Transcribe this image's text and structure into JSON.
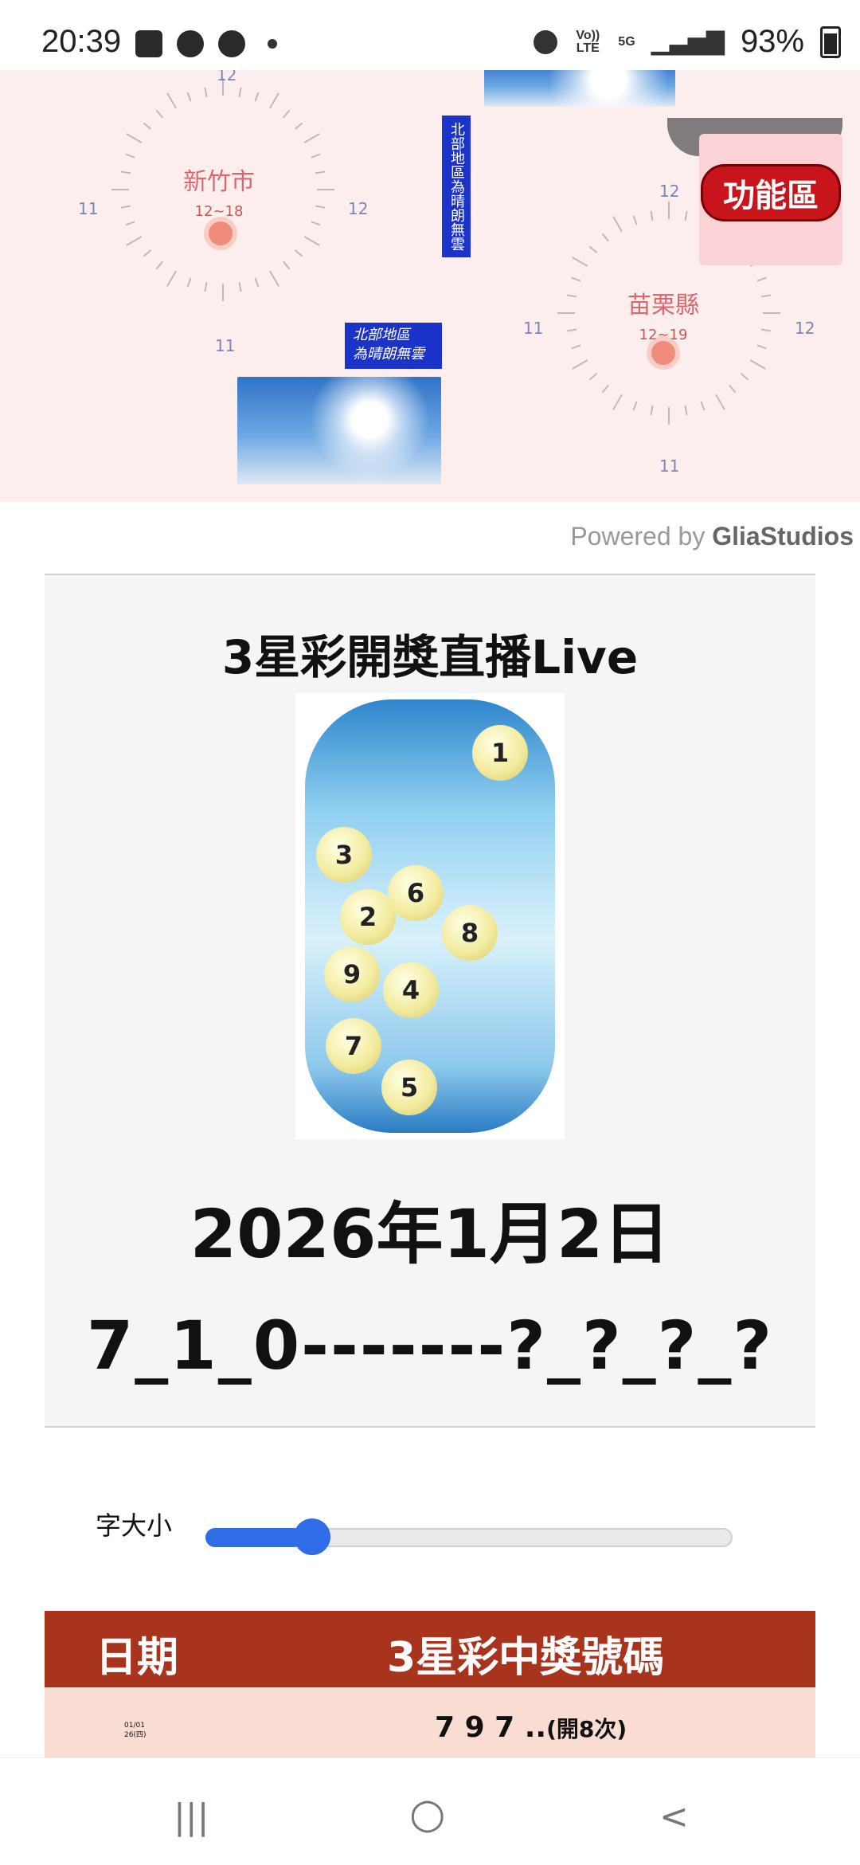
{
  "status_bar": {
    "time": "20:39",
    "icons_left": [
      "gallery-icon",
      "facebook-icon",
      "chat-icon",
      "dot"
    ],
    "alarm": "alarm-icon",
    "volte": "Vo)) LTE",
    "net": "5G",
    "battery": "93%"
  },
  "weather_banner": {
    "city1": {
      "name": "新竹市",
      "range": "12~18",
      "tick_top": "12",
      "tick_left": "11",
      "tick_right": "12",
      "tick_bottom": "11"
    },
    "city2": {
      "name": "苗栗縣",
      "range": "12~19",
      "tick_top": "12",
      "tick_left": "11",
      "tick_right": "12",
      "tick_bottom": "11"
    },
    "vertical_sign": "北部地區為晴朗無雲",
    "horizontal_sign_line1": "北部地區",
    "horizontal_sign_line2": "為晴朗無雲",
    "feature_button": "功能區"
  },
  "powered": {
    "prefix": "Powered by ",
    "brand": "GliaStudios"
  },
  "live": {
    "title": "3星彩開獎直播Live",
    "balls": [
      "1",
      "3",
      "2",
      "6",
      "8",
      "9",
      "4",
      "7",
      "5"
    ],
    "date": "2026年1月2日",
    "numbers": "7_1_0-------?_?_?_?"
  },
  "font_size": {
    "label": "字大小",
    "value_fraction": 0.15
  },
  "table": {
    "headers": [
      "日期",
      "3星彩中獎號碼"
    ],
    "rows": [
      {
        "date_line1": "01/01",
        "date_line2": "26(四)",
        "numbers": "7 9 7 ..",
        "note": "(開8次)"
      }
    ]
  },
  "nav": {
    "recent": "|||",
    "home": "○",
    "back": "<"
  }
}
